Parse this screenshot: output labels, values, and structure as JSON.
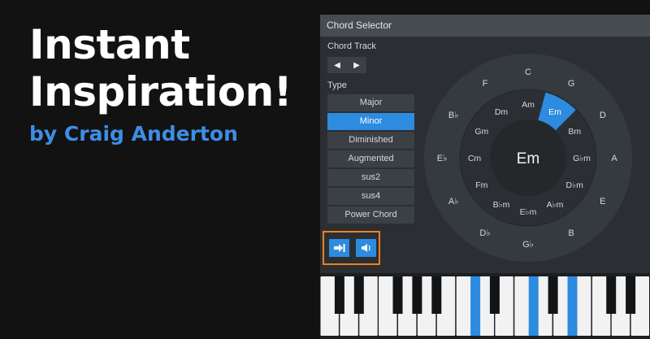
{
  "promo": {
    "headline_line1": "Instant",
    "headline_line2": "Inspiration!",
    "byline": "by Craig Anderton"
  },
  "chord_selector": {
    "title": "Chord Selector",
    "chord_track_label": "Chord Track",
    "prev_icon": "chevron-left-icon",
    "next_icon": "chevron-right-icon",
    "type_label": "Type",
    "types": [
      {
        "label": "Major",
        "active": false
      },
      {
        "label": "Minor",
        "active": true
      },
      {
        "label": "Diminished",
        "active": false
      },
      {
        "label": "Augmented",
        "active": false
      },
      {
        "label": "sus2",
        "active": false
      },
      {
        "label": "sus4",
        "active": false
      },
      {
        "label": "Power Chord",
        "active": false
      }
    ],
    "bottom_buttons": [
      {
        "icon": "insert-chord-icon"
      },
      {
        "icon": "speaker-icon"
      }
    ],
    "highlight_color": "#f0801c",
    "accent_color": "#2d8be0"
  },
  "circle_of_fifths": {
    "current_chord": "Em",
    "major_keys": [
      "C",
      "G",
      "D",
      "A",
      "E",
      "B",
      "G♭",
      "D♭",
      "A♭",
      "E♭",
      "B♭",
      "F"
    ],
    "minor_keys": [
      "Am",
      "Em",
      "Bm",
      "G♭m",
      "D♭m",
      "A♭m",
      "E♭m",
      "B♭m",
      "Fm",
      "Cm",
      "Gm",
      "Dm"
    ],
    "selected_minor_index": 1
  },
  "piano": {
    "white_keys": 17,
    "highlighted_black_keys": [
      5,
      7,
      9
    ],
    "highlight_color": "#2d8be0"
  }
}
